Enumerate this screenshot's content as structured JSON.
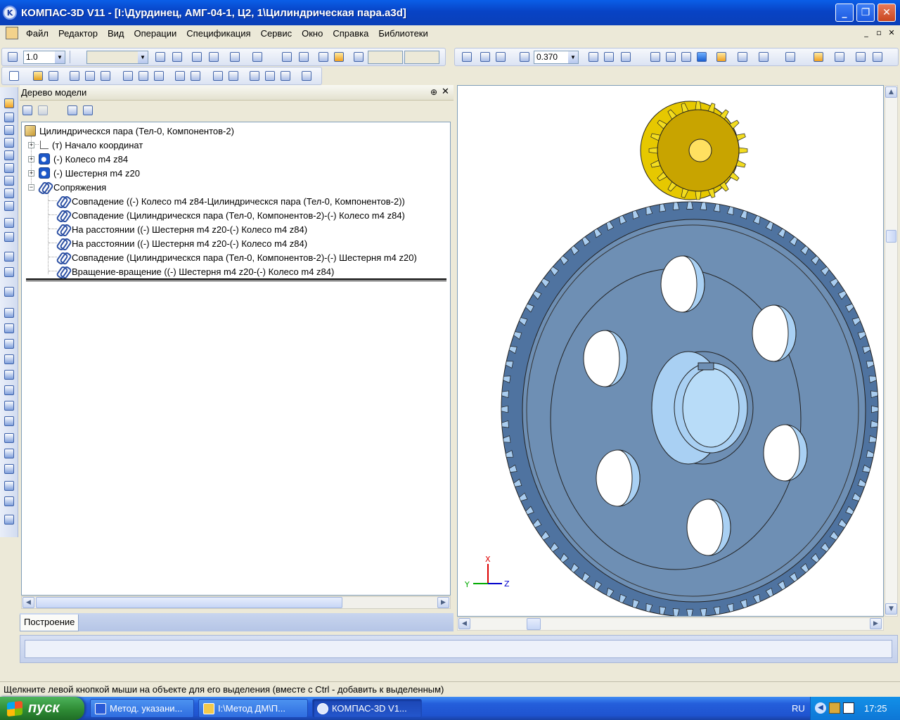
{
  "window": {
    "title": "КОМПАС-3D V11 - [I:\\Дурдинец, АМГ-04-1, Ц2, 1\\Цилиндрическая пара.a3d]",
    "app_icon": "K"
  },
  "menu": [
    "Файл",
    "Редактор",
    "Вид",
    "Операции",
    "Спецификация",
    "Сервис",
    "Окно",
    "Справка",
    "Библиотеки"
  ],
  "toolbar": {
    "step_value": "1.0",
    "zoom_value": "0.370"
  },
  "tree_panel": {
    "title": "Дерево модели",
    "pin_icon": "pin-icon",
    "close_icon": "close-icon",
    "root": "Цилиндрическся пара (Тел-0, Компонентов-2)",
    "items": [
      {
        "label": "(т) Начало координат",
        "icon": "axis-icon"
      },
      {
        "label": "(-) Колесо m4 z84",
        "icon": "part-icon"
      },
      {
        "label": "(-) Шестерня m4 z20",
        "icon": "part-icon"
      },
      {
        "label": "Сопряжения",
        "icon": "mate-icon"
      }
    ],
    "mates": [
      "Совпадение ((-) Колесо m4 z84-Цилиндрическся пара (Тел-0, Компонентов-2))",
      "Совпадение (Цилиндрическся пара (Тел-0, Компонентов-2)-(-) Колесо m4 z84)",
      "На расстоянии ((-) Шестерня m4 z20-(-) Колесо m4 z84)",
      "На расстоянии ((-) Шестерня m4 z20-(-) Колесо m4 z84)",
      "Совпадение (Цилиндрическся пара (Тел-0, Компонентов-2)-(-) Шестерня m4 z20)",
      "Вращение-вращение ((-) Шестерня m4 z20-(-) Колесо m4 z84)"
    ],
    "tab": "Построение"
  },
  "viewport": {
    "axis_x": "X",
    "axis_y": "Y",
    "axis_z": "Z",
    "colors": {
      "gear_large": "#6e8fb4",
      "gear_small": "#c8a400"
    }
  },
  "status": "Щелкните левой кнопкой мыши на объекте для его выделения (вместе с Ctrl - добавить к выделенным)",
  "taskbar": {
    "start": "пуск",
    "tasks": [
      "Метод. указани...",
      "I:\\Метод ДМ\\П...",
      "КОМПАС-3D V1..."
    ],
    "lang": "RU",
    "clock": "17:25"
  }
}
